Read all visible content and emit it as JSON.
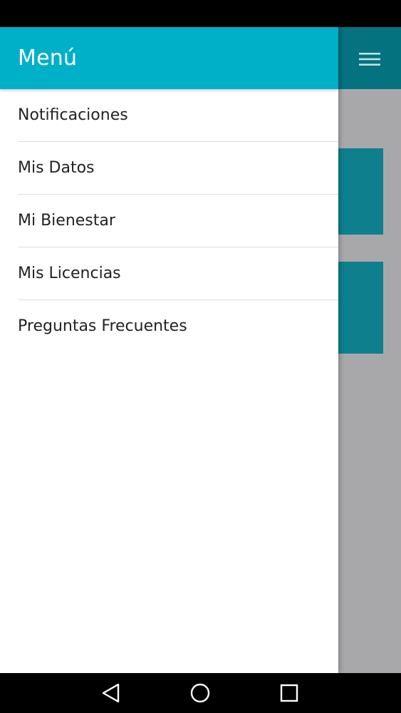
{
  "drawer": {
    "title": "Menú",
    "items": [
      {
        "label": "Notificaciones"
      },
      {
        "label": "Mis Datos"
      },
      {
        "label": "Mi Bienestar"
      },
      {
        "label": "Mis Licencias"
      },
      {
        "label": "Preguntas Frecuentes"
      }
    ]
  },
  "background_app": {
    "menu_icon": "hamburger-icon"
  },
  "system_nav": {
    "back_icon": "back-triangle-icon",
    "home_icon": "home-circle-icon",
    "recent_icon": "recent-apps-square-icon"
  },
  "colors": {
    "drawer_header": "#00b0c8",
    "background_header": "#04727f",
    "background_card": "#0e7f8d",
    "scrim": "#a8a8aa"
  }
}
